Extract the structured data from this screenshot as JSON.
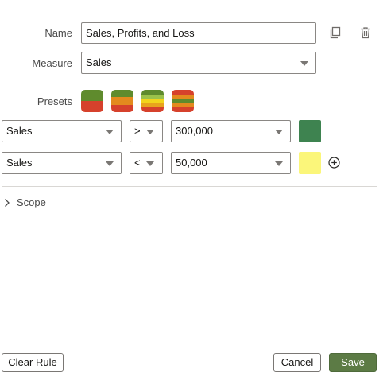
{
  "name": {
    "label": "Name",
    "value": "Sales, Profits, and Loss"
  },
  "measure": {
    "label": "Measure",
    "value": "Sales"
  },
  "presets": {
    "label": "Presets",
    "items": [
      {
        "stripes": [
          "#5f8b2d",
          "#d6412c"
        ]
      },
      {
        "stripes": [
          "#5f8b2d",
          "#e38a1e",
          "#d6412c"
        ]
      },
      {
        "stripes": [
          "#5f8b2d",
          "#9bc24b",
          "#f2d41c",
          "#e8a31d",
          "#d6412c"
        ]
      },
      {
        "stripes": [
          "#d6412c",
          "#e38a1e",
          "#5f8b2d",
          "#e38a1e",
          "#d6412c"
        ]
      }
    ]
  },
  "rules": [
    {
      "measure": "Sales",
      "operator": ">",
      "value": "300,000",
      "color": "#3e8350"
    },
    {
      "measure": "Sales",
      "operator": "<",
      "value": "50,000",
      "color": "#fbf67a"
    }
  ],
  "scope": {
    "label": "Scope"
  },
  "buttons": {
    "clear_rule": "Clear Rule",
    "cancel": "Cancel",
    "save": "Save"
  }
}
